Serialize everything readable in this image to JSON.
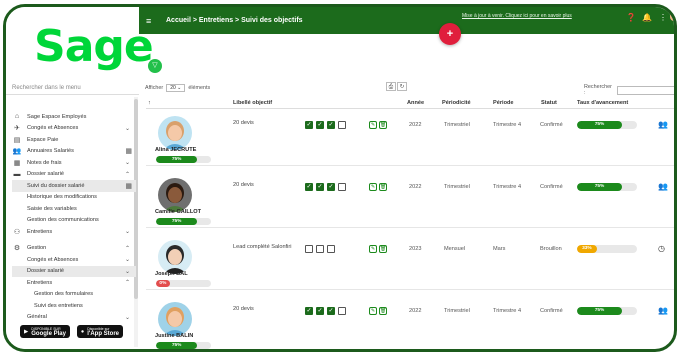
{
  "app": {
    "logo": "Sage",
    "sidebar_search_placeholder": "Rechercher dans le menu",
    "breadcrumb": "Accueil > Entretiens > Suivi des objectifs",
    "top_link": "Mise à jour à venir. Cliquez ici pour en savoir plus",
    "plus_label": "+"
  },
  "colors": {
    "brand_green": "#1c6b1c",
    "logo_green": "#00d639",
    "accent_red": "#e01e3c",
    "progress_green": "#1c8a1c",
    "progress_orange": "#f0a800",
    "progress_red": "#e34c4c"
  },
  "sidebar": {
    "items": [
      {
        "label": "Sage Espace Employés",
        "icon": "home-icon",
        "style": "",
        "chev": "",
        "grid": false
      },
      {
        "label": "Congés et Absences",
        "icon": "plane-icon",
        "style": "",
        "chev": "⌄",
        "grid": false
      },
      {
        "label": "Espace Paie",
        "icon": "doc-icon",
        "style": "",
        "chev": "",
        "grid": false
      },
      {
        "label": "Annuaires Salariés",
        "icon": "people-icon",
        "style": "",
        "chev": "",
        "grid": true
      },
      {
        "label": "Notes de frais",
        "icon": "receipt-icon",
        "style": "",
        "chev": "⌄",
        "grid": false
      },
      {
        "label": "Dossier salarié",
        "icon": "folder-icon",
        "style": "",
        "chev": "⌃",
        "grid": false
      },
      {
        "label": "Suivi du dossier salarié",
        "icon": "",
        "style": "sub active",
        "chev": "",
        "grid": true
      },
      {
        "label": "Historique des modifications",
        "icon": "",
        "style": "sub",
        "chev": "",
        "grid": false
      },
      {
        "label": "Saisie des variables",
        "icon": "",
        "style": "sub",
        "chev": "",
        "grid": false
      },
      {
        "label": "Gestion des communications",
        "icon": "",
        "style": "sub",
        "chev": "",
        "grid": false
      },
      {
        "label": "Entretiens",
        "icon": "handshake-icon",
        "style": "",
        "chev": "⌄",
        "grid": false
      },
      {
        "label": "Gestion",
        "icon": "gear-icon",
        "style": "gap",
        "chev": "⌃",
        "grid": false
      },
      {
        "label": "Congés et Absences",
        "icon": "",
        "style": "sub",
        "chev": "⌄",
        "grid": false
      },
      {
        "label": "Dossier salarié",
        "icon": "",
        "style": "sub active",
        "chev": "⌄",
        "grid": false
      },
      {
        "label": "Entretiens",
        "icon": "",
        "style": "sub",
        "chev": "⌃",
        "grid": false
      },
      {
        "label": "Gestion des formulaires",
        "icon": "",
        "style": "sub2",
        "chev": "",
        "grid": false
      },
      {
        "label": "Suivi des entretiens",
        "icon": "",
        "style": "sub2",
        "chev": "",
        "grid": false
      },
      {
        "label": "Général",
        "icon": "",
        "style": "sub",
        "chev": "⌄",
        "grid": false
      }
    ],
    "google_play": {
      "small": "DISPONIBLE SUR",
      "big": "Google Play"
    },
    "app_store": {
      "small": "Disponible sur",
      "big": "l'App Store"
    }
  },
  "table": {
    "show_label": "Afficher",
    "show_value": "20",
    "elements_label": "éléments",
    "search_label": "Rechercher :",
    "headers": {
      "libelle": "Libellé objectif",
      "annee": "Année",
      "periodicite": "Périodicité",
      "periode": "Période",
      "statut": "Statut",
      "taux": "Taux d'avancement"
    },
    "rows": [
      {
        "name": "Alina JECRUTE",
        "emp_pct": "75%",
        "emp_frac": 0.75,
        "emp_color": "#1c8a1c",
        "libelle": "20 devis",
        "checks": [
          true,
          true,
          true,
          false
        ],
        "annee": "2022",
        "periodicite": "Trimestriel",
        "periode": "Trimestre 4",
        "statut": "Confirmé",
        "pct": "75%",
        "frac": 0.75,
        "color": "#1c8a1c",
        "icon": "group-icon",
        "skin": "#f5c9a8",
        "hair": "#d9a06b",
        "shirt": "#5aa9d6",
        "bg": "#bfe3f2"
      },
      {
        "name": "Camille GAILLOT",
        "emp_pct": "75%",
        "emp_frac": 0.75,
        "emp_color": "#1c8a1c",
        "libelle": "20 devis",
        "checks": [
          true,
          true,
          true,
          false
        ],
        "annee": "2022",
        "periodicite": "Trimestriel",
        "periode": "Trimestre 4",
        "statut": "Confirmé",
        "pct": "75%",
        "frac": 0.75,
        "color": "#1c8a1c",
        "icon": "group-icon",
        "skin": "#8a5a3b",
        "hair": "#2b1a10",
        "shirt": "#4c7a3c",
        "bg": "#6f6f6f"
      },
      {
        "name": "Joseph BAL",
        "emp_pct": "0%",
        "emp_frac": 0.25,
        "emp_color": "#e34c4c",
        "libelle": "Lead complété Salonfiri",
        "checks": [
          false,
          false,
          false
        ],
        "annee": "2023",
        "periodicite": "Mensuel",
        "periode": "Mars",
        "statut": "Brouillon",
        "pct": "33%",
        "frac": 0.33,
        "color": "#f0a800",
        "icon": "clock-icon",
        "skin": "#f2cfb6",
        "hair": "#2a2a2a",
        "shirt": "#222222",
        "bg": "#d7ecf4"
      },
      {
        "name": "Justine BALIN",
        "emp_pct": "75%",
        "emp_frac": 0.75,
        "emp_color": "#1c8a1c",
        "libelle": "20 devis",
        "checks": [
          true,
          true,
          true,
          false
        ],
        "annee": "2022",
        "periodicite": "Trimestriel",
        "periode": "Trimestre 4",
        "statut": "Confirmé",
        "pct": "75%",
        "frac": 0.75,
        "color": "#1c8a1c",
        "icon": "group-icon",
        "skin": "#f5c9a8",
        "hair": "#e0a060",
        "shirt": "#5aa9d6",
        "bg": "#9fd2e8"
      }
    ]
  }
}
